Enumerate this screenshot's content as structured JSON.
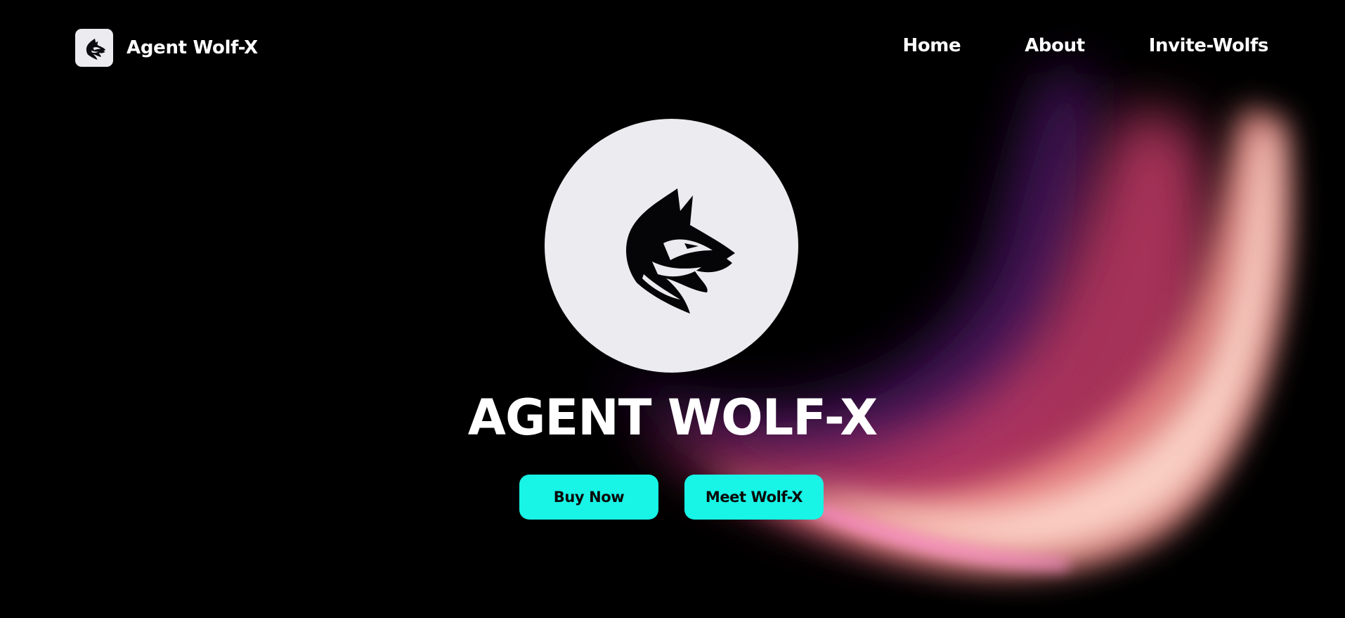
{
  "header": {
    "brand_name": "Agent Wolf-X",
    "brand_logo_icon": "wolf-head-icon",
    "nav": [
      {
        "label": "Home"
      },
      {
        "label": "About"
      },
      {
        "label": "Invite-Wolfs"
      }
    ]
  },
  "hero": {
    "emblem_icon": "wolf-head-icon",
    "title": "AGENT WOLF-X",
    "buttons": {
      "buy_now": "Buy Now",
      "meet": "Meet Wolf-X"
    }
  },
  "colors": {
    "background": "#000000",
    "accent": "#18f4e6",
    "emblem_bg": "#ebebf0",
    "glow_purple": "#5a1a6e",
    "glow_pink": "#e0457a",
    "glow_peach": "#ffd2c4"
  }
}
